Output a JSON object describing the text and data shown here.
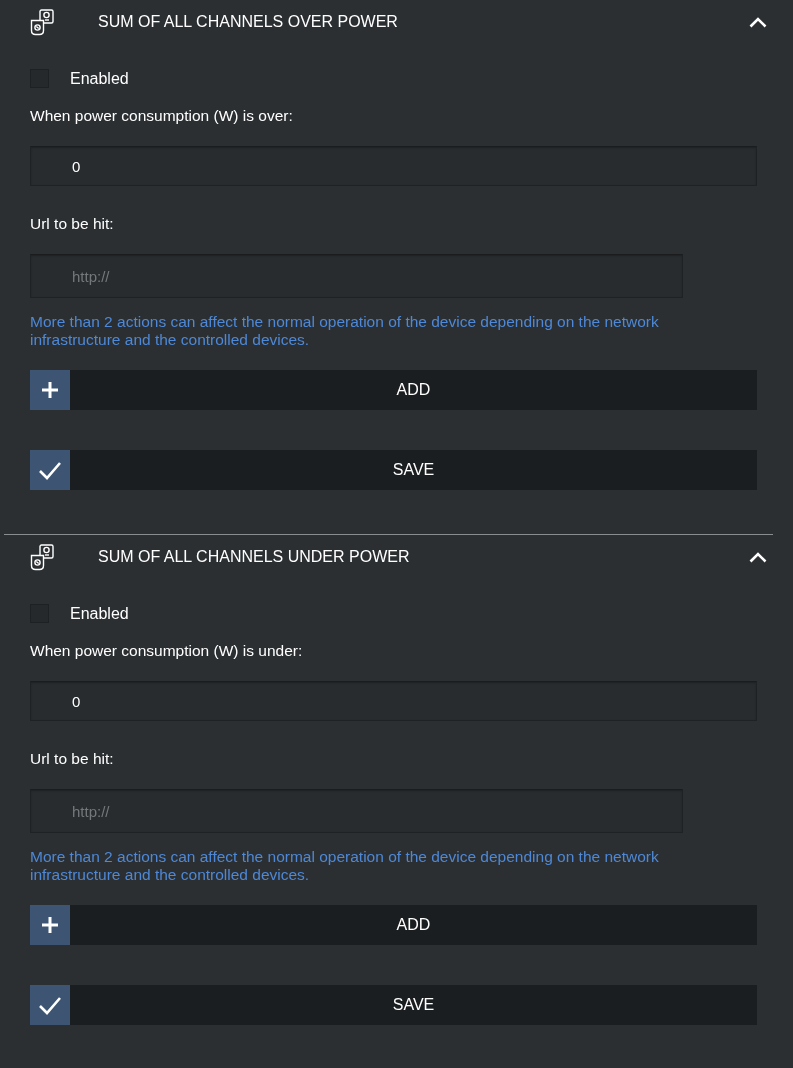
{
  "sections": [
    {
      "title": "SUM OF ALL CHANNELS OVER POWER",
      "expanded": true,
      "enabled": {
        "label": "Enabled",
        "checked": false
      },
      "threshold": {
        "label": "When power consumption (W) is over:",
        "value": "0"
      },
      "url": {
        "label": "Url to be hit:",
        "placeholder": "http://"
      },
      "note": "More than 2 actions can affect the normal operation of the device depending on the network infrastructure and the controlled devices.",
      "buttons": [
        {
          "kind": "add",
          "label": "ADD"
        },
        {
          "kind": "save",
          "label": "SAVE"
        }
      ]
    },
    {
      "title": "SUM OF ALL CHANNELS UNDER POWER",
      "expanded": true,
      "enabled": {
        "label": "Enabled",
        "checked": false
      },
      "threshold": {
        "label": "When power consumption (W) is under:",
        "value": "0"
      },
      "url": {
        "label": "Url to be hit:",
        "placeholder": "http://"
      },
      "note": "More than 2 actions can affect the normal operation of the device depending on the network infrastructure and the controlled devices.",
      "buttons": [
        {
          "kind": "add",
          "label": "ADD"
        },
        {
          "kind": "save",
          "label": "SAVE"
        }
      ]
    }
  ]
}
